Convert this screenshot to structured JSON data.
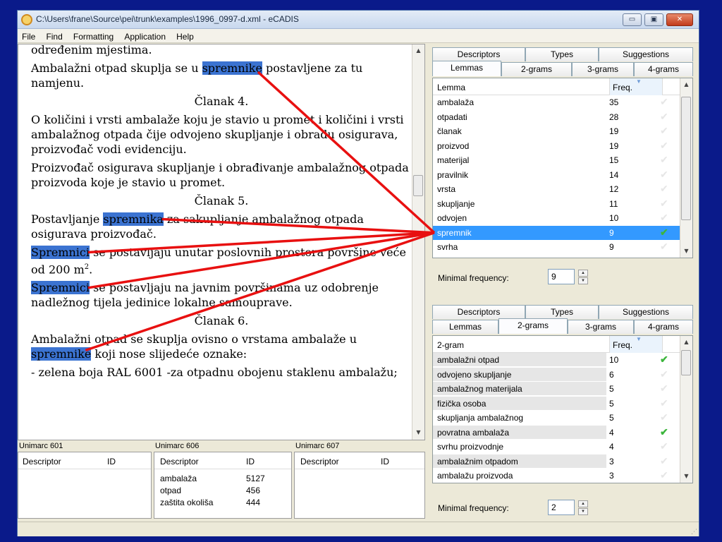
{
  "window": {
    "title": "C:\\Users\\frane\\Source\\pei\\trunk\\examples\\1996_0997-d.xml - eCADIS",
    "min_glyph": "▭",
    "max_glyph": "▣",
    "close_glyph": "✕"
  },
  "menu": [
    "File",
    "Find",
    "Formatting",
    "Application",
    "Help"
  ],
  "document": {
    "line0": "određenim mjestima.",
    "p1_a": "Ambalažni otpad skuplja se u ",
    "p1_hl": "spremnike",
    "p1_b": " postavljene za tu namjenu.",
    "h4": "Članak 4.",
    "p2": "O količini i vrsti ambalaže koju je stavio u promet i količini i vrsti ambalažnog otpada čije odvojeno skupljanje i obradu osigurava, proizvođač vodi evidenciju.",
    "p3": "Proizvođač osigurava skupljanje i obrađivanje ambalažnog otpada proizvoda koje je stavio u promet.",
    "h5": "Članak 5.",
    "p4_a": "Postavljanje ",
    "p4_hl": "spremnika",
    "p4_b": " za sakupljanje ambalažnog otpada osigurava proizvođač.",
    "p5_hl": "Spremnici",
    "p5_b": " se postavljaju unutar poslovnih prostora površine veće od 200 m",
    "p5_sup": "2",
    "p5_c": ".",
    "p6_hl": "Spremnici",
    "p6_b": " se postavljaju na javnim površinama uz odobrenje nadležnog tijela jedinice lokalne samouprave.",
    "h6": "Članak 6.",
    "p7_a": "Ambalažni otpad se skuplja ovisno o vrstama ambalaže u ",
    "p7_hl": "spremnike",
    "p7_b": " koji nose slijedeće oznake:",
    "p8": "- zelena boja RAL 6001 -za otpadnu obojenu staklenu ambalažu;",
    "highlight_color": "#3b73d1"
  },
  "unimarc": [
    {
      "label": "Unimarc 601",
      "col1": "Descriptor",
      "col2": "ID",
      "rows": []
    },
    {
      "label": "Unimarc 606",
      "col1": "Descriptor",
      "col2": "ID",
      "rows": [
        {
          "d": "ambalaža",
          "id": "5127"
        },
        {
          "d": "otpad",
          "id": "456"
        },
        {
          "d": "zaštita okoliša",
          "id": "444"
        }
      ]
    },
    {
      "label": "Unimarc 607",
      "col1": "Descriptor",
      "col2": "ID",
      "rows": []
    }
  ],
  "panel_top": {
    "tabs_back": [
      "Descriptors",
      "Types",
      "Suggestions"
    ],
    "tabs_front": [
      "Lemmas",
      "2-grams",
      "3-grams",
      "4-grams"
    ],
    "active_tab": "Lemmas",
    "col1": "Lemma",
    "col2": "Freq.",
    "rows": [
      {
        "t": "ambalaža",
        "f": "35",
        "checked": false
      },
      {
        "t": "otpadati",
        "f": "28",
        "checked": false
      },
      {
        "t": "članak",
        "f": "19",
        "checked": false
      },
      {
        "t": "proizvod",
        "f": "19",
        "checked": false
      },
      {
        "t": "materijal",
        "f": "15",
        "checked": false
      },
      {
        "t": "pravilnik",
        "f": "14",
        "checked": false
      },
      {
        "t": "vrsta",
        "f": "12",
        "checked": false
      },
      {
        "t": "skupljanje",
        "f": "11",
        "checked": false
      },
      {
        "t": "odvojen",
        "f": "10",
        "checked": false
      },
      {
        "t": "spremnik",
        "f": "9",
        "checked": true,
        "selected": true
      },
      {
        "t": "svrha",
        "f": "9",
        "checked": false
      }
    ],
    "min_freq_label": "Minimal frequency:",
    "min_freq_value": "9"
  },
  "panel_bottom": {
    "tabs_back": [
      "Descriptors",
      "Types",
      "Suggestions"
    ],
    "tabs_front": [
      "Lemmas",
      "2-grams",
      "3-grams",
      "4-grams"
    ],
    "active_tab": "2-grams",
    "col1": "2-gram",
    "col2": "Freq.",
    "rows": [
      {
        "t": "ambalažni otpad",
        "f": "10",
        "checked": true,
        "grey": true
      },
      {
        "t": "odvojeno skupljanje",
        "f": "6",
        "checked": false,
        "grey": true
      },
      {
        "t": "ambalažnog materijala",
        "f": "5",
        "checked": false,
        "grey": true
      },
      {
        "t": "fizička osoba",
        "f": "5",
        "checked": false,
        "grey": true
      },
      {
        "t": "skupljanja ambalažnog",
        "f": "5",
        "checked": false,
        "grey": false
      },
      {
        "t": "povratna ambalaža",
        "f": "4",
        "checked": true,
        "grey": true
      },
      {
        "t": "svrhu proizvodnje",
        "f": "4",
        "checked": false,
        "grey": false
      },
      {
        "t": "ambalažnim otpadom",
        "f": "3",
        "checked": false,
        "grey": true
      },
      {
        "t": "ambalažu proizvoda",
        "f": "3",
        "checked": false,
        "grey": false
      }
    ],
    "min_freq_label": "Minimal frequency:",
    "min_freq_value": "2"
  },
  "check_glyph": "✔",
  "arrow_color": "#e81010"
}
